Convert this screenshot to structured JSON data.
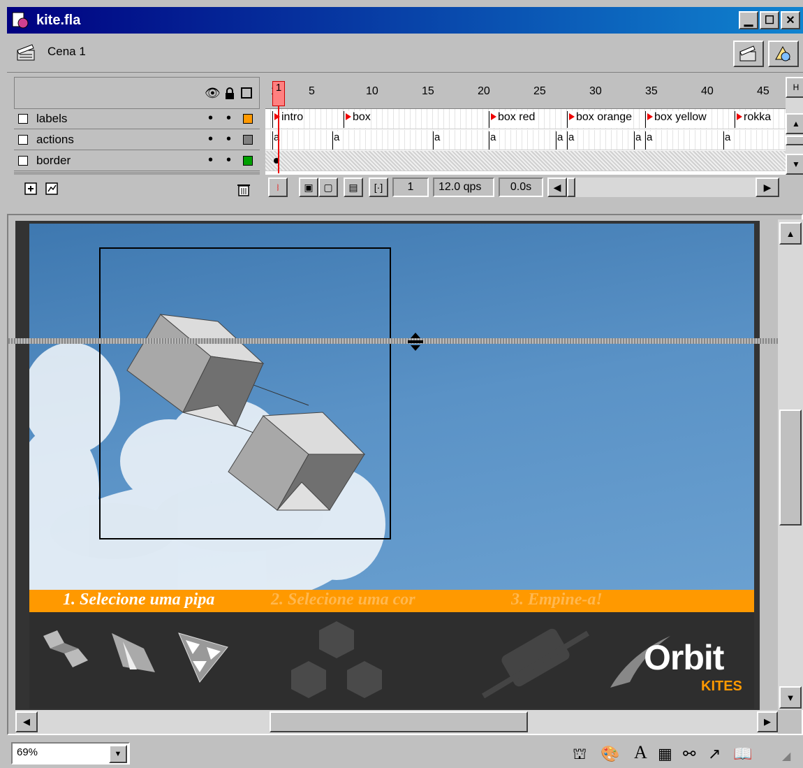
{
  "window": {
    "title": "kite.fla"
  },
  "scene": {
    "name": "Cena 1"
  },
  "timeline": {
    "ruler_numbers": [
      "1",
      "5",
      "10",
      "15",
      "20",
      "25",
      "30",
      "35",
      "40",
      "45"
    ],
    "layers": [
      {
        "name": "labels",
        "color": "#ff9900"
      },
      {
        "name": "actions",
        "color": "#808080"
      },
      {
        "name": "border",
        "color": "#00a000"
      }
    ],
    "frame_labels": [
      "intro",
      "box",
      "box red",
      "box orange",
      "box yellow",
      "rokka"
    ],
    "action_marker": "a",
    "current_frame": "1",
    "frame_rate": "12.0 qps",
    "elapsed": "0.0s"
  },
  "stage": {
    "steps": [
      "1. Selecione uma pipa",
      "2. Selecione uma cor",
      "3. Empine-a!"
    ],
    "logo_main": "Orbit",
    "logo_sub": "KITES",
    "colors": {
      "accent": "#ff9900",
      "sky": "#4a86bf",
      "dark": "#2e2e2e"
    }
  },
  "status": {
    "zoom": "69%"
  },
  "icons": [
    "scene-icon",
    "edit-scene-icon",
    "edit-symbol-icon",
    "eye-icon",
    "lock-icon",
    "outline-icon",
    "layer-icon",
    "add-layer-icon",
    "add-guide-icon",
    "trash-icon",
    "onion-skin-icon",
    "center-frame-icon",
    "scroll-left-icon",
    "scroll-right-icon",
    "scroll-up-icon",
    "scroll-down-icon",
    "dropdown-icon",
    "timeline-icon",
    "color-icon",
    "text-icon",
    "library-icon",
    "movie-explorer-icon",
    "actions-icon",
    "reference-icon"
  ]
}
